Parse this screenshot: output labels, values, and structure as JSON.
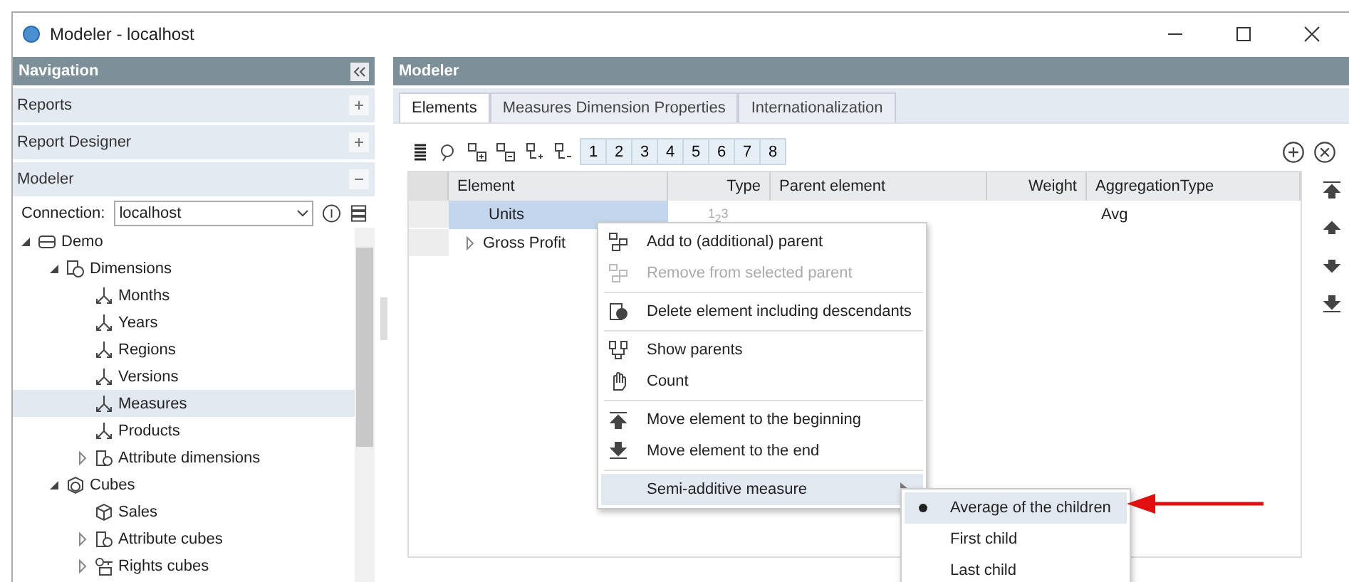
{
  "window": {
    "title": "Modeler - localhost"
  },
  "navigation": {
    "title": "Navigation",
    "sections": [
      {
        "label": "Reports",
        "expanded": false
      },
      {
        "label": "Report Designer",
        "expanded": false
      },
      {
        "label": "Modeler",
        "expanded": true
      }
    ],
    "connection": {
      "label": "Connection:",
      "value": "localhost"
    },
    "tree": [
      {
        "label": "Demo",
        "kind": "database",
        "expanded": true,
        "selected": false,
        "children": [
          {
            "label": "Dimensions",
            "kind": "dimensions",
            "expanded": true,
            "selected": false,
            "children": [
              {
                "label": "Months",
                "kind": "dimension",
                "selected": false
              },
              {
                "label": "Years",
                "kind": "dimension",
                "selected": false
              },
              {
                "label": "Regions",
                "kind": "dimension",
                "selected": false
              },
              {
                "label": "Versions",
                "kind": "dimension",
                "selected": false
              },
              {
                "label": "Measures",
                "kind": "dimension",
                "selected": true
              },
              {
                "label": "Products",
                "kind": "dimension",
                "selected": false
              },
              {
                "label": "Attribute dimensions",
                "kind": "attribute",
                "expanded": false,
                "selected": false
              }
            ]
          },
          {
            "label": "Cubes",
            "kind": "cubes",
            "expanded": true,
            "selected": false,
            "children": [
              {
                "label": "Sales",
                "kind": "cube",
                "selected": false
              },
              {
                "label": "Attribute cubes",
                "kind": "attribute",
                "expanded": false,
                "selected": false
              },
              {
                "label": "Rights cubes",
                "kind": "rights",
                "expanded": false,
                "selected": false
              }
            ]
          }
        ]
      }
    ]
  },
  "modeler": {
    "title": "Modeler",
    "tabs": [
      {
        "label": "Elements",
        "selected": true
      },
      {
        "label": "Measures Dimension Properties",
        "selected": false
      },
      {
        "label": "Internationalization",
        "selected": false
      }
    ],
    "levels": [
      "1",
      "2",
      "3",
      "4",
      "5",
      "6",
      "7",
      "8"
    ],
    "table": {
      "columns": [
        "Element",
        "Type",
        "Parent element",
        "Weight",
        "AggregationType"
      ],
      "rows": [
        {
          "element": "Units",
          "type": "1$_{2}$3",
          "aggregation": "Avg",
          "selected": true
        },
        {
          "element": "Gross Profit",
          "expanded": false,
          "selected": false
        }
      ]
    }
  },
  "context_menu": {
    "sections": [
      [
        {
          "label": "Add to (additional) parent",
          "disabled": false
        },
        {
          "label": "Remove from selected parent",
          "disabled": true
        }
      ],
      [
        {
          "label": "Delete element including descendants",
          "disabled": false
        }
      ],
      [
        {
          "label": "Show parents",
          "disabled": false
        },
        {
          "label": "Count",
          "disabled": false
        }
      ],
      [
        {
          "label": "Move element to the beginning",
          "disabled": false
        },
        {
          "label": "Move element to the end",
          "disabled": false
        }
      ],
      [
        {
          "label": "Semi-additive measure",
          "disabled": false,
          "highlighted": true,
          "submenu": true
        }
      ]
    ],
    "submenu": [
      {
        "label": "Average of the children",
        "selected": true
      },
      {
        "label": "First child",
        "selected": false
      },
      {
        "label": "Last child",
        "selected": false
      }
    ]
  }
}
